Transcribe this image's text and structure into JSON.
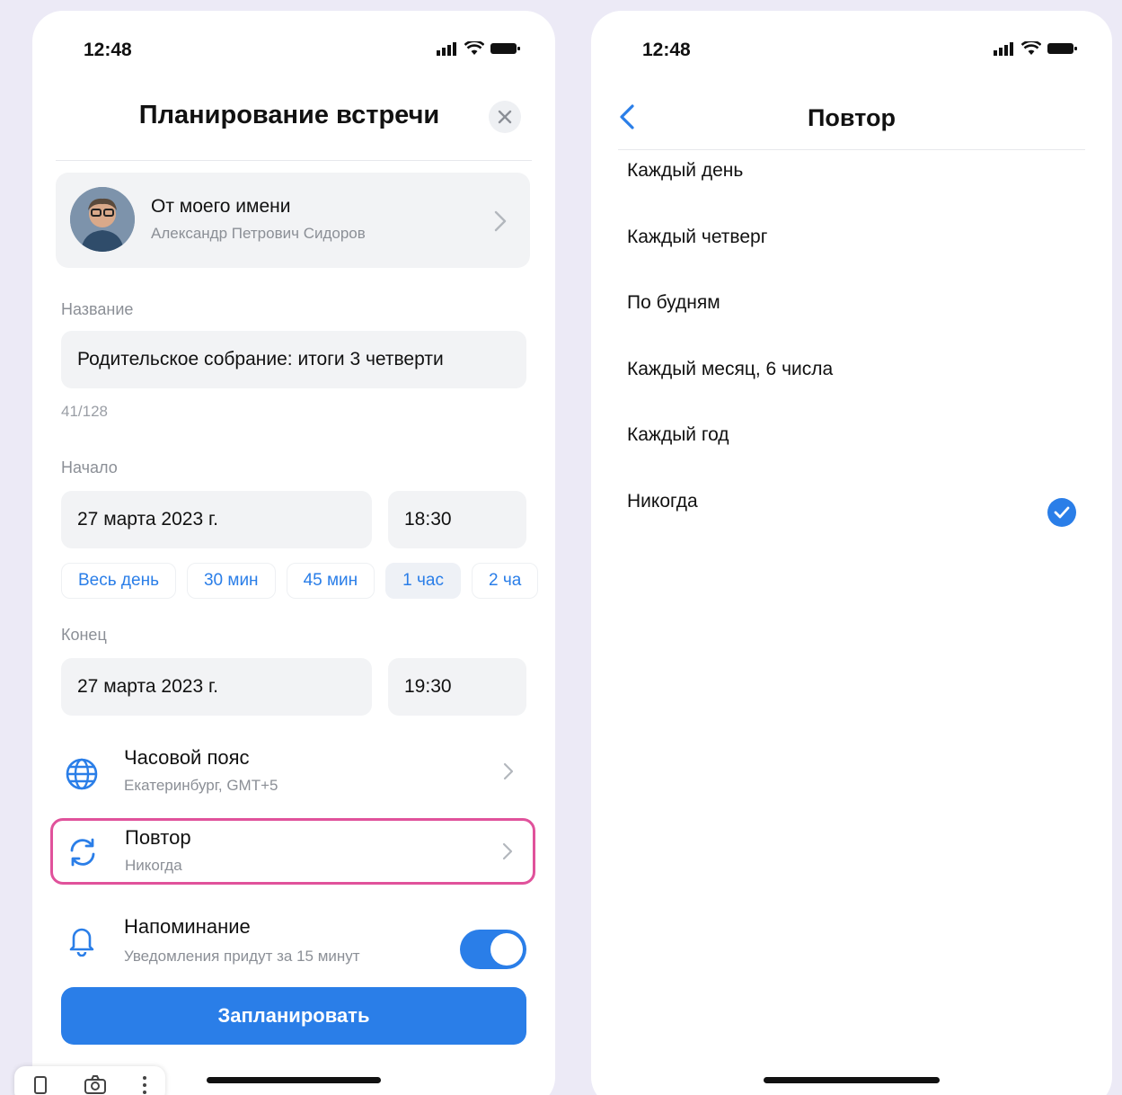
{
  "left_screen": {
    "status_time": "12:48",
    "title": "Планирование встречи",
    "author": {
      "title": "От моего имени",
      "name": "Александр Петрович Сидоров"
    },
    "name_field": {
      "label": "Название",
      "value": "Родительское собрание: итоги 3 четверти",
      "counter": "41/128"
    },
    "start": {
      "label": "Начало",
      "date": "27 марта 2023 г.",
      "time": "18:30"
    },
    "durations": [
      "Весь день",
      "30 мин",
      "45 мин",
      "1 час",
      "2 ча"
    ],
    "selected_duration": "1 час",
    "end": {
      "label": "Конец",
      "date": "27 марта 2023 г.",
      "time": "19:30"
    },
    "timezone": {
      "title": "Часовой пояс",
      "value": "Екатеринбург, GMT+5"
    },
    "repeat": {
      "title": "Повтор",
      "value": "Никогда"
    },
    "reminder": {
      "title": "Напоминание",
      "value": "Уведомления придут за 15 минут",
      "enabled": true
    },
    "submit_label": "Запланировать"
  },
  "right_screen": {
    "status_time": "12:48",
    "title": "Повтор",
    "options": [
      "Каждый день",
      "Каждый четверг",
      "По будням",
      "Каждый месяц, 6 числа",
      "Каждый год",
      "Никогда"
    ],
    "selected_option": "Никогда"
  },
  "colors": {
    "accent": "#2a7ee8",
    "highlight": "#e0529b",
    "background": "#eceaf6"
  }
}
